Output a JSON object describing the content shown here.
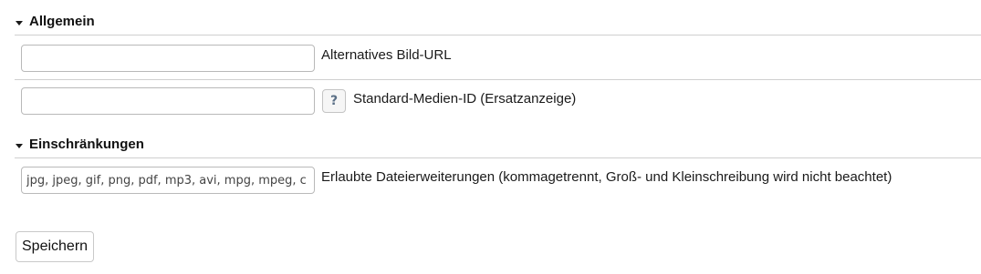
{
  "sections": {
    "general": {
      "title": "Allgemein"
    },
    "restrictions": {
      "title": "Einschränkungen"
    }
  },
  "fields": {
    "alt_image_url": {
      "label": "Alternatives Bild-URL",
      "value": ""
    },
    "default_media_id": {
      "label": "Standard-Medien-ID (Ersatzanzeige)",
      "value": "",
      "help_label": "?"
    },
    "allowed_extensions": {
      "label": "Erlaubte Dateierweiterungen (kommagetrennt, Groß- und Kleinschreibung wird nicht beachtet)",
      "value": "jpg, jpeg, gif, png, pdf, mp3, avi, mpg, mpeg, c"
    }
  },
  "actions": {
    "save_label": "Speichern"
  },
  "icons": {
    "section_toggle": "caret-down-icon",
    "help": "question-mark-icon"
  }
}
